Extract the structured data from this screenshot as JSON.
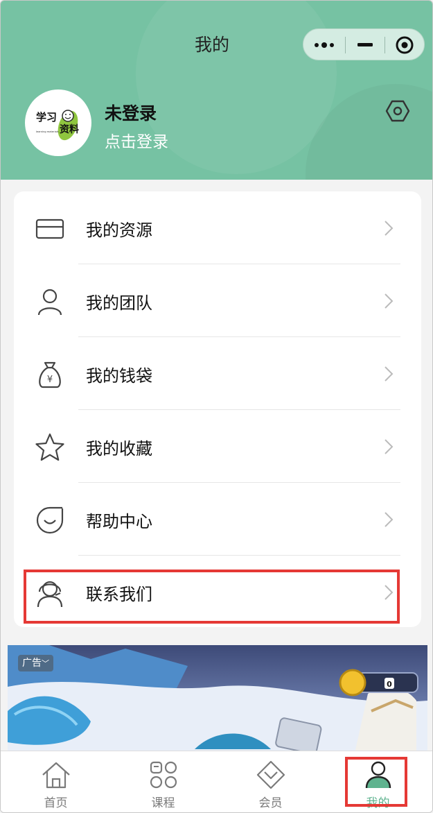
{
  "nav": {
    "title": "我的"
  },
  "profile": {
    "logo_text_top": "学习",
    "logo_text_bottom": "资料",
    "logo_text_small": "learning materials",
    "username": "未登录",
    "login_link": "点击登录"
  },
  "menu": [
    {
      "label": "我的资源",
      "icon": "card-icon"
    },
    {
      "label": "我的团队",
      "icon": "person-icon"
    },
    {
      "label": "我的钱袋",
      "icon": "money-bag-icon"
    },
    {
      "label": "我的收藏",
      "icon": "star-icon"
    },
    {
      "label": "帮助中心",
      "icon": "help-icon"
    },
    {
      "label": "联系我们",
      "icon": "headset-icon"
    }
  ],
  "ad": {
    "tag": "广告",
    "score": "0"
  },
  "tabs": [
    {
      "label": "首页",
      "icon": "home-icon"
    },
    {
      "label": "课程",
      "icon": "grid-icon"
    },
    {
      "label": "会员",
      "icon": "vip-icon"
    },
    {
      "label": "我的",
      "icon": "profile-icon",
      "active": true
    }
  ],
  "colors": {
    "header": "#76c2a3",
    "accent": "#5fb38f",
    "highlight": "#e53935"
  }
}
